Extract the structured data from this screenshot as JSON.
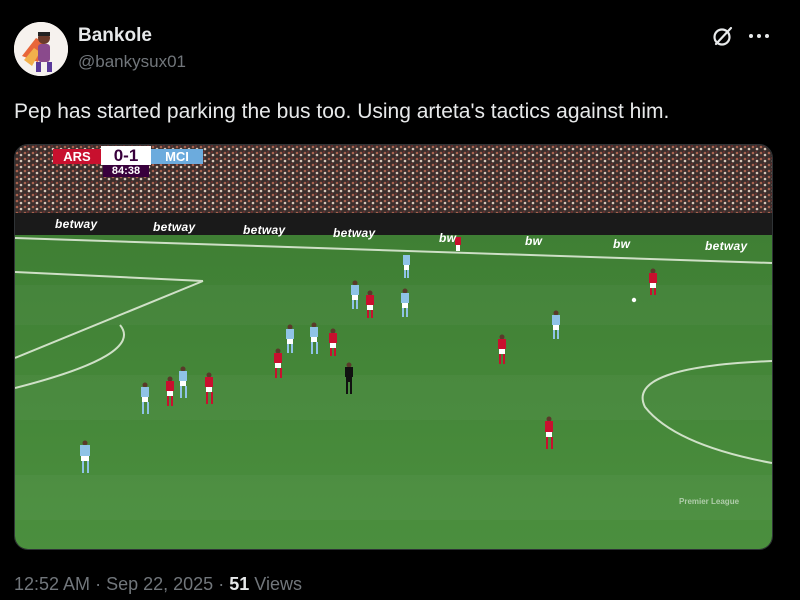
{
  "user": {
    "display_name": "Bankole",
    "handle": "@bankysux01"
  },
  "tweet": {
    "text": "Pep has started parking the bus too. Using arteta's tactics against him."
  },
  "media": {
    "scoreboard": {
      "home": "ARS",
      "score": "0-1",
      "away": "MCI",
      "clock": "84:38"
    },
    "ad_boards": [
      "betway",
      "betway",
      "betway",
      "betway",
      "bw",
      "bw",
      "bw",
      "betway"
    ],
    "watermark": "Premier League"
  },
  "meta": {
    "time": "12:52 AM",
    "separator": "·",
    "date": "Sep 22, 2025",
    "views_count": "51",
    "views_label": "Views"
  },
  "icons": {
    "grok": "grok-icon",
    "more": "more-icon"
  },
  "colors": {
    "background": "#000000",
    "text_primary": "#e7e9ea",
    "text_secondary": "#71767b",
    "arsenal_red": "#c8102e",
    "city_blue": "#6cabdd",
    "pitch_green": "#4a8a3c"
  }
}
